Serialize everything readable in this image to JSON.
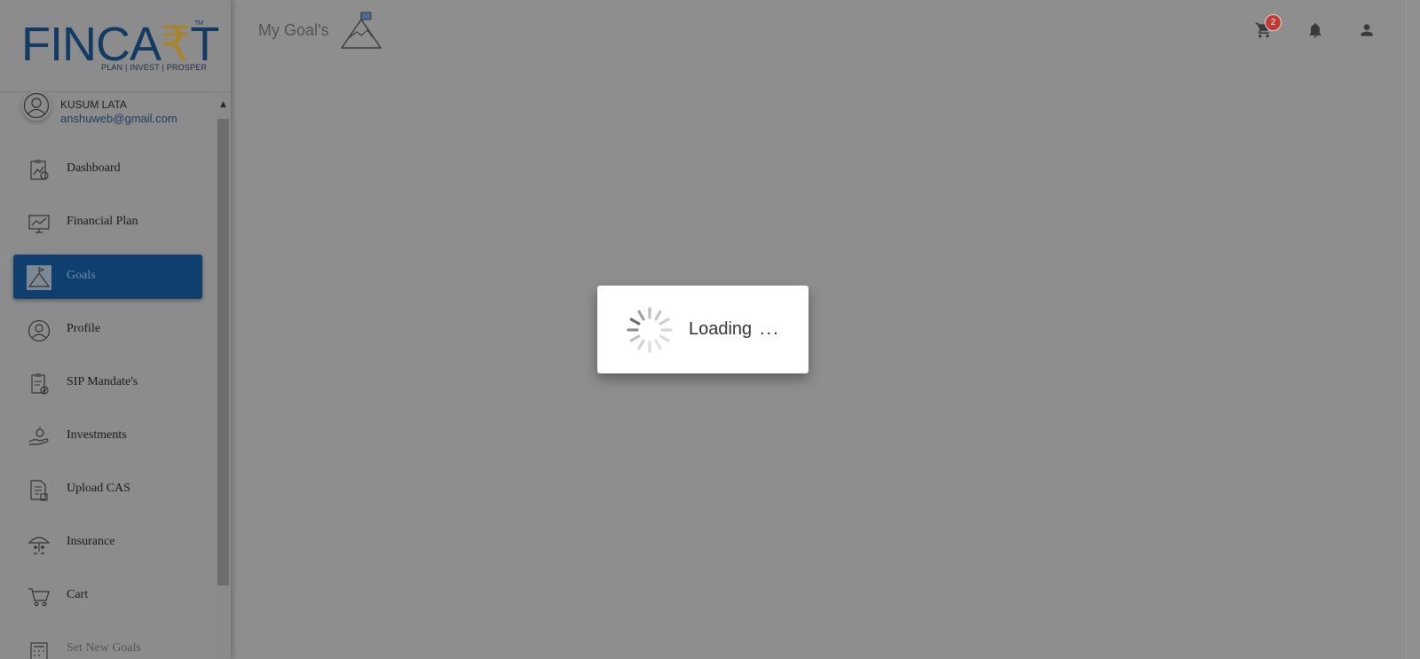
{
  "logo": {
    "brand_left": "FINCA",
    "brand_rupee": "₹",
    "brand_right": "T",
    "tm": "TM",
    "tagline": "PLAN | INVEST | PROSPER"
  },
  "user": {
    "name": "KUSUM LATA",
    "email": "anshuweb@gmail.com"
  },
  "sidebar": {
    "items": [
      {
        "label": "Dashboard",
        "icon": "clipboard-chart-icon"
      },
      {
        "label": "Financial Plan",
        "icon": "monitor-chart-icon"
      },
      {
        "label": "Goals",
        "icon": "mountain-flag-icon",
        "active": true
      },
      {
        "label": "Profile",
        "icon": "user-circle-icon"
      },
      {
        "label": "SIP Mandate's",
        "icon": "clipboard-check-icon"
      },
      {
        "label": "Investments",
        "icon": "hand-coin-icon"
      },
      {
        "label": "Upload CAS",
        "icon": "document-upload-icon"
      },
      {
        "label": "Insurance",
        "icon": "umbrella-family-icon"
      },
      {
        "label": "Cart",
        "icon": "cart-icon"
      },
      {
        "label": "Set New Goals",
        "icon": "calculator-goal-icon"
      }
    ]
  },
  "header": {
    "title": "My Goal's",
    "cart_count": "2"
  },
  "loading": {
    "text": "Loading",
    "dots": "..."
  },
  "colors": {
    "overlay": "#8e8e8e",
    "brand_blue": "#123a63",
    "brand_gold": "#a8842e",
    "active_nav": "#0f3f6e",
    "badge": "#c23a34"
  }
}
